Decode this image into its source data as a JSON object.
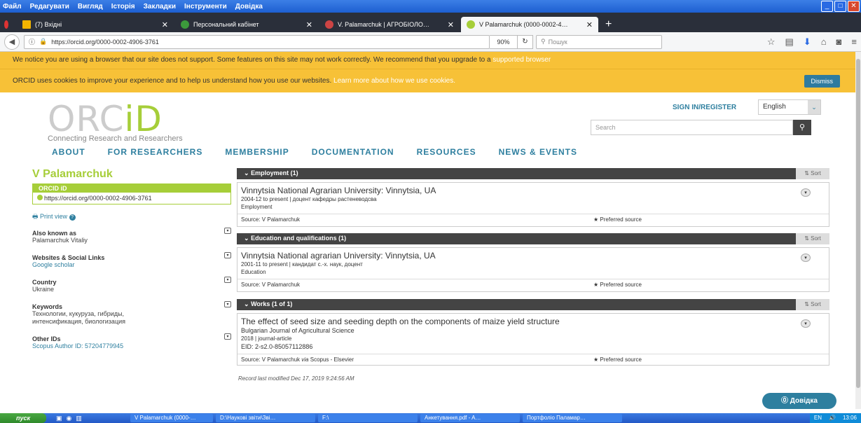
{
  "browser": {
    "menu": [
      "Файл",
      "Редагувати",
      "Вигляд",
      "Історія",
      "Закладки",
      "Інструменти",
      "Довідка"
    ],
    "tabs": [
      {
        "label": "(7) Вхідні",
        "active": false
      },
      {
        "label": "Персональний кабінет",
        "active": false
      },
      {
        "label": "V. Palamarchuk | АГРОБІОЛО…",
        "active": false
      },
      {
        "label": "V Palamarchuk (0000-0002-4…",
        "active": true
      }
    ],
    "url": "https://orcid.org/0000-0002-4906-3761",
    "zoom": "90%",
    "search_placeholder": "Пошук"
  },
  "banners": {
    "unsupported_text": "We notice you are using a browser that our site does not support. Some features on this site may not work correctly. We recommend that you upgrade to a",
    "unsupported_link": "supported browser",
    "cookies_text": "ORCID uses cookies to improve your experience and to help us understand how you use our websites.",
    "cookies_link": "Learn more about how we use cookies.",
    "dismiss": "Dismiss"
  },
  "header": {
    "logo_text_a": "ORC",
    "logo_text_b": "iD",
    "tagline": "Connecting Research and Researchers",
    "signin": "SIGN IN/REGISTER",
    "language": "English",
    "search_placeholder": "Search"
  },
  "nav": [
    "ABOUT",
    "FOR RESEARCHERS",
    "MEMBERSHIP",
    "DOCUMENTATION",
    "RESOURCES",
    "NEWS & EVENTS"
  ],
  "profile": {
    "name": "V Palamarchuk",
    "orcid_label": "ORCID iD",
    "orcid_url": "https://orcid.org/0000-0002-4906-3761",
    "print_view": "Print view",
    "also_known_title": "Also known as",
    "also_known_value": "Palamarchuk Vitaliy",
    "websites_title": "Websites & Social Links",
    "websites_value": "Google scholar",
    "country_title": "Country",
    "country_value": "Ukraine",
    "keywords_title": "Keywords",
    "keywords_value_1": "Технологии, кукуруза, гибриды,",
    "keywords_value_2": "интенсификация, биологизация",
    "other_ids_title": "Other IDs",
    "other_ids_value": "Scopus Author ID: 57204779945"
  },
  "sections": {
    "employment": {
      "header": "Employment (1)",
      "sort": "Sort",
      "title": "Vinnytsia National Agrarian University: Vinnytsia, UA",
      "line1": "2004-12 to present | доцент кафедры растеневодсва",
      "line2": "Employment",
      "source": "Source: V Palamarchuk",
      "preferred": "Preferred source"
    },
    "education": {
      "header": "Education and qualifications (1)",
      "sort": "Sort",
      "title": "Vinnytsia National agrarian University: Vinnytsia, UA",
      "line1": "2001-11 to present | кандидат с.-х. наук, доцент",
      "line2": "Education",
      "source": "Source: V Palamarchuk",
      "preferred": "Preferred source"
    },
    "works": {
      "header": "Works (1 of 1)",
      "sort": "Sort",
      "title": "The effect of seed size and seeding depth on the components of maize yield structure",
      "journal": "Bulgarian Journal of Agricultural Science",
      "line1": "2018 | journal-article",
      "eid": "EID: 2-s2.0-85057112886",
      "source_a": "Source: V Palamarchuk",
      "source_via": "via",
      "source_b": "Scopus - Elsevier",
      "preferred": "Preferred source"
    }
  },
  "modified": "Record last modified Dec 17, 2019 9:24:56 AM",
  "help": "Довідка",
  "taskbar": {
    "start": "пуск",
    "tasks": [
      "V Palamarchuk (0000-…",
      "D:\\Наукові звіти\\Зві…",
      "F:\\",
      "Анкетування.pdf - A…",
      "Портфоліо Паламар…"
    ],
    "lang": "EN",
    "time": "13:06"
  }
}
